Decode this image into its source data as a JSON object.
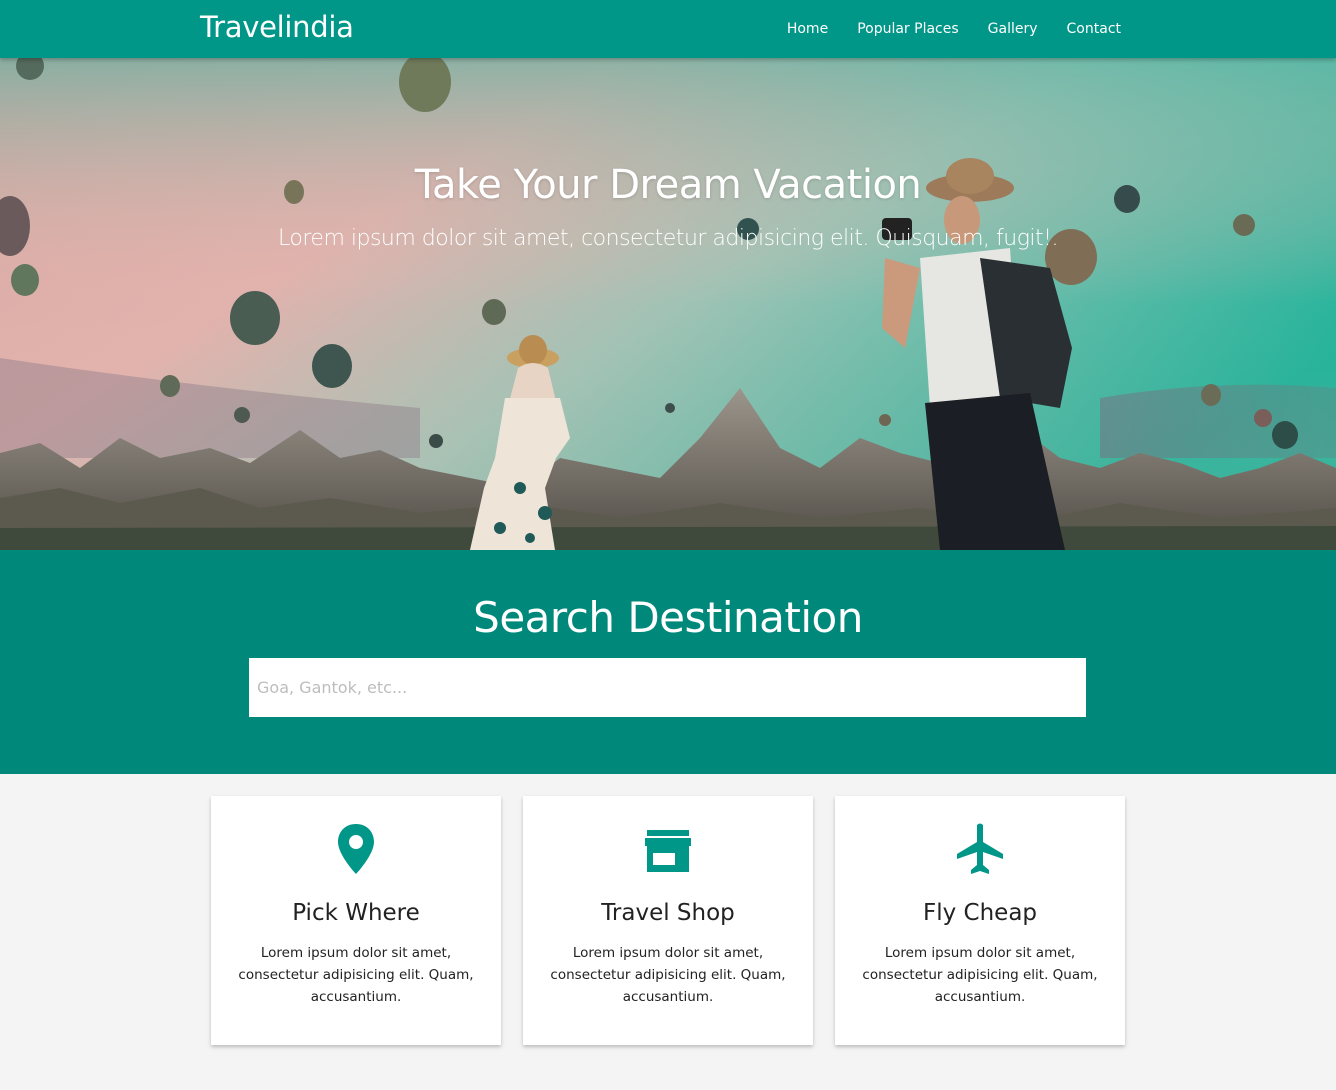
{
  "navbar": {
    "brand": "Travelindia",
    "links": [
      "Home",
      "Popular Places",
      "Gallery",
      "Contact"
    ]
  },
  "hero": {
    "title": "Take Your Dream Vacation",
    "subtitle": "Lorem ipsum dolor sit amet, consectetur adipisicing elit. Quisquam, fugit!."
  },
  "search": {
    "title": "Search Destination",
    "placeholder": "Goa, Gantok, etc..."
  },
  "cards": [
    {
      "icon": "location-pin-icon",
      "title": "Pick Where",
      "text": "Lorem ipsum dolor sit amet, consectetur adipisicing elit. Quam, accusantium."
    },
    {
      "icon": "store-icon",
      "title": "Travel Shop",
      "text": "Lorem ipsum dolor sit amet, consectetur adipisicing elit. Quam, accusantium."
    },
    {
      "icon": "airplane-icon",
      "title": "Fly Cheap",
      "text": "Lorem ipsum dolor sit amet, consectetur adipisicing elit. Quam, accusantium."
    }
  ],
  "colors": {
    "primary": "#009688",
    "search_bg": "#00897b",
    "page_bg": "#f4f4f4"
  }
}
